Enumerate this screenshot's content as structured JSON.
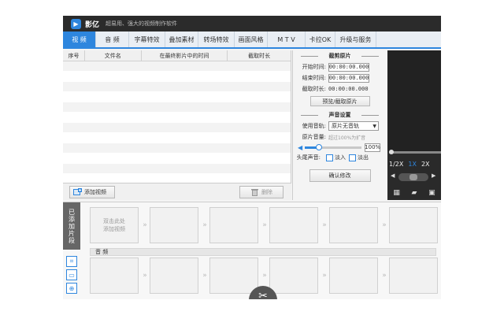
{
  "app": {
    "name": "影亿",
    "slogan": "超易用、强大的视频制作软件",
    "accent_color": "#2e86de"
  },
  "tabs": [
    {
      "label": "视 频",
      "active": true
    },
    {
      "label": "音 频",
      "active": false
    },
    {
      "label": "字幕特效",
      "active": false
    },
    {
      "label": "叠加素材",
      "active": false
    },
    {
      "label": "转场特效",
      "active": false
    },
    {
      "label": "画面风格",
      "active": false
    },
    {
      "label": "M T V",
      "active": false
    },
    {
      "label": "卡拉OK",
      "active": false
    },
    {
      "label": "升级与服务",
      "active": false
    }
  ],
  "file_list": {
    "columns": [
      "序号",
      "文件名",
      "在最终影片中的时间",
      "截取时长"
    ],
    "add_button": "添加视频",
    "delete_button": "删除"
  },
  "clip_section": {
    "title": "截剪原片",
    "start_label": "开始时间:",
    "start_value": "00:00:00.000",
    "end_label": "结束时间:",
    "end_value": "00:00:00.000",
    "duration_label": "截取时长:",
    "duration_value": "00:00:00.000",
    "preview_button": "预览/截取原片"
  },
  "audio_section": {
    "title": "声音设置",
    "track_label": "使用音轨:",
    "track_value": "原片无音轨",
    "volume_label": "原片音量:",
    "volume_hint": "超过100%为扩音",
    "volume_value": "100%",
    "volume_fraction": 0.25,
    "fade_label": "头尾声音:",
    "fade_in": "淡入",
    "fade_out": "淡出",
    "confirm_button": "确认修改"
  },
  "preview": {
    "speed_options": [
      "1/2X",
      "1X",
      "2X"
    ],
    "speed_selected": "1X"
  },
  "timeline": {
    "added_label": "已添加片段",
    "placeholder_clip": "双击此处\n添加视频",
    "audio_track_label": "音 频"
  },
  "icons": {
    "add": "film-plus-icon",
    "delete": "trash-icon",
    "scissors": "scissors-icon",
    "crop": "crop-icon",
    "speaker": "speaker-icon"
  }
}
